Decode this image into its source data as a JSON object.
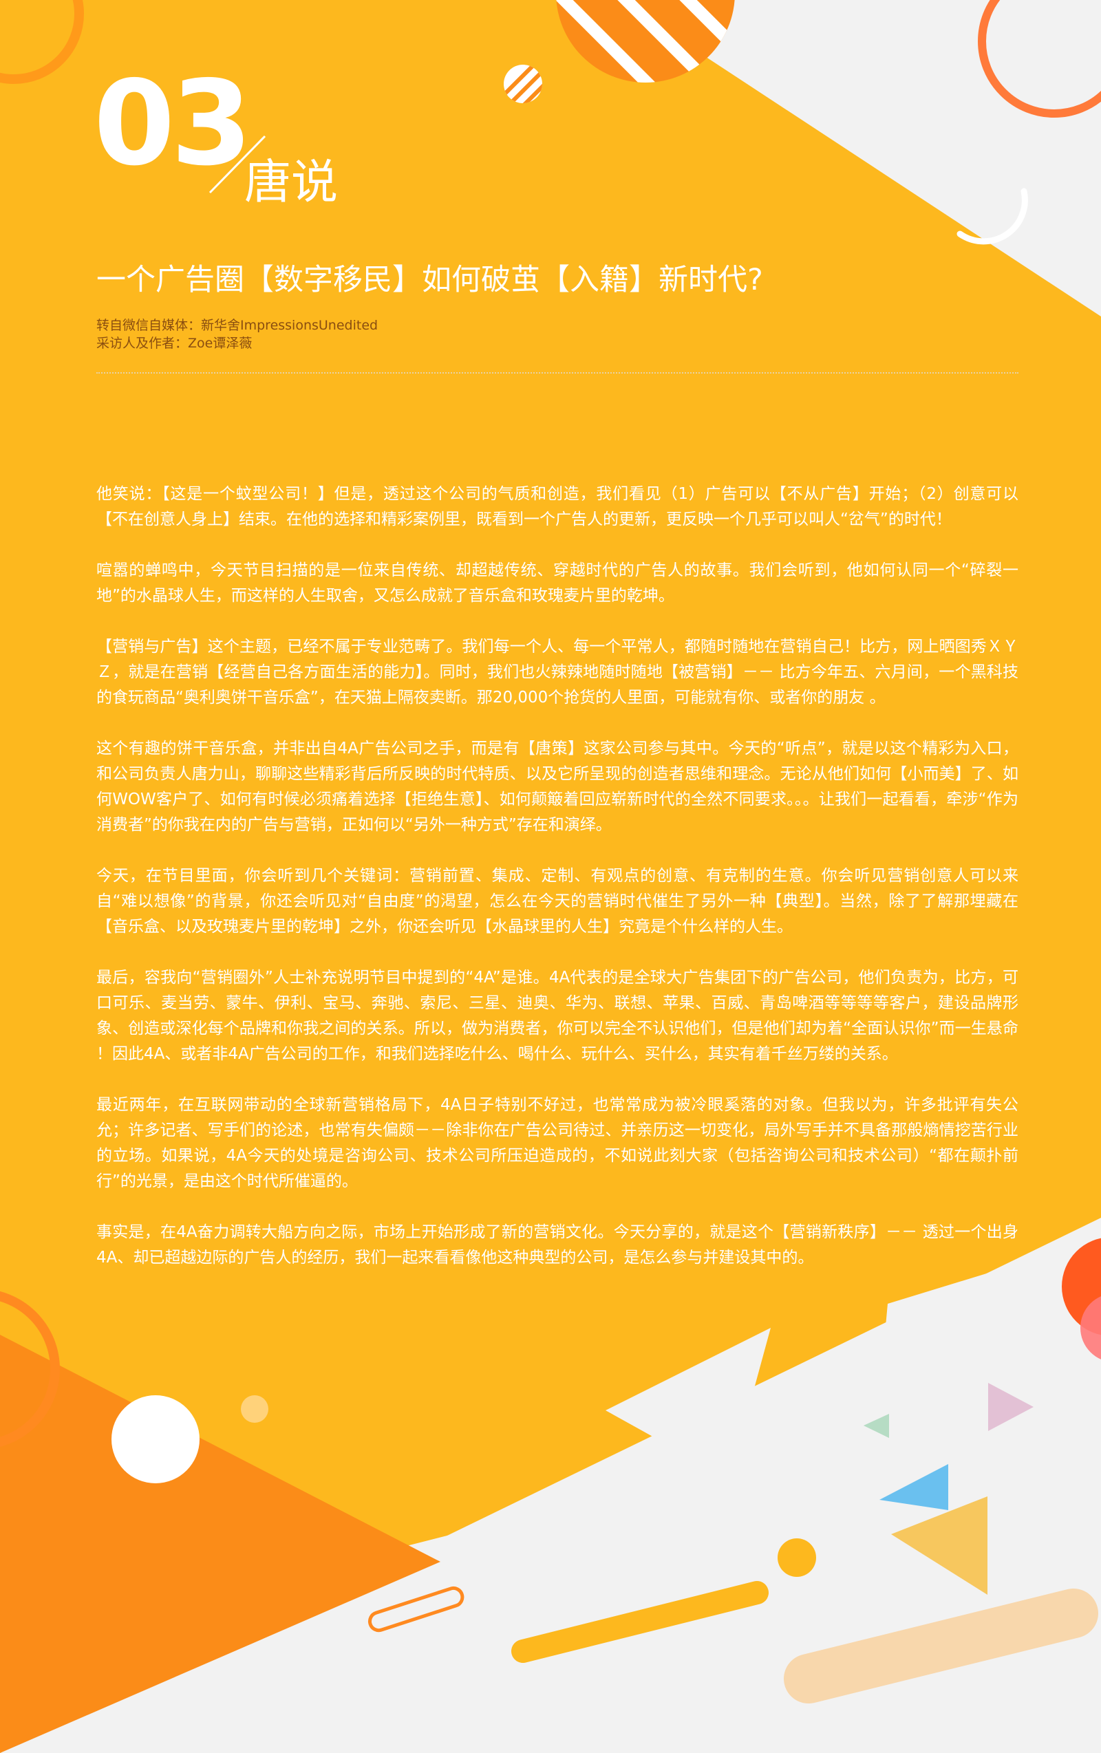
{
  "header": {
    "section_number": "03",
    "section_name": "唐说",
    "headline": "一个广告圈【数字移民】如何破茧【入籍】新时代?",
    "source_line": "转自微信自媒体：新华舍ImpressionsUnedited",
    "author_line": "采访人及作者：Zoe谭泽薇"
  },
  "article": {
    "paragraphs": [
      "他笑说：【这是一个蚊型公司！】但是，透过这个公司的气质和创造，我们看见（1）广告可以【不从广告】开始；（2）创意可以【不在创意人身上】结束。在他的选择和精彩案例里，既看到一个广告人的更新，更反映一个几乎可以叫人“岔气”的时代！",
      "喧嚣的蝉鸣中，今天节目扫描的是一位来自传统、却超越传统、穿越时代的广告人的故事。我们会听到，他如何认同一个“碎裂一地”的水晶球人生，而这样的人生取舍，又怎么成就了音乐盒和玫瑰麦片里的乾坤。",
      "【营销与广告】这个主题，已经不属于专业范畴了。我们每一个人、每一个平常人，都随时随地在营销自己！比方，网上晒图秀ＸＹＺ，就是在营销【经营自己各方面生活的能力】。同时，我们也火辣辣地随时随地【被营销】－－ 比方今年五、六月间，一个黑科技的食玩商品“奥利奥饼干音乐盒”，在天猫上隔夜卖断。那20,000个抢货的人里面，可能就有你、或者你的朋友 。",
      "这个有趣的饼干音乐盒，并非出自4A广告公司之手，而是有【唐策】这家公司参与其中。今天的“听点”，就是以这个精彩为入口，和公司负责人唐力山，聊聊这些精彩背后所反映的时代特质、以及它所呈现的创造者思维和理念。无论从他们如何【小而美】了、如何WOW客户了、如何有时候必须痛着选择【拒绝生意】、如何颠簸着回应崭新时代的全然不同要求。。。让我们一起看看，牵涉“作为消费者”的你我在内的广告与营销，正如何以“另外一种方式”存在和演绎。",
      "今天，在节目里面，你会听到几个关键词：营销前置、集成、定制、有观点的创意、有克制的生意。你会听见营销创意人可以来自“难以想像”的背景，你还会听见对“自由度”的渴望，怎么在今天的营销时代催生了另外一种【典型】。当然，除了了解那埋藏在【音乐盒、以及玫瑰麦片里的乾坤】之外，你还会听见【水晶球里的人生】究竟是个什么样的人生。",
      "最后，容我向“营销圈外”人士补充说明节目中提到的“4A”是谁。4A代表的是全球大广告集团下的广告公司，他们负责为，比方，可口可乐、麦当劳、蒙牛、伊利、宝马、奔驰、索尼、三星、迪奥、华为、联想、苹果、百威、青岛啤酒等等等等客户，建设品牌形象、创造或深化每个品牌和你我之间的关系。所以，做为消费者，你可以完全不认识他们，但是他们却为着“全面认识你”而一生悬命 ！因此4A、或者非4A广告公司的工作，和我们选择吃什么、喝什么、玩什么、买什么，其实有着千丝万缕的关系。",
      "最近两年，在互联网带动的全球新营销格局下，4A日子特别不好过，也常常成为被冷眼奚落的对象。但我以为，许多批评有失公允；许多记者、写手们的论述，也常有失偏颇－－除非你在广告公司待过、并亲历这一切变化，局外写手并不具备那般熵情挖苦行业的立场。如果说，4A今天的处境是咨询公司、技术公司所压迫造成的，不如说此刻大家（包括咨询公司和技术公司）“都在颠扑前行”的光景，是由这个时代所催逼的。",
      "事实是，在4A奋力调转大船方向之际，市场上开始形成了新的营销文化。今天分享的，就是这个【营销新秩序】－－ 透过一个出身4A、却已超越边际的广告人的经历，我们一起来看看像他这种典型的公司，是怎么参与并建设其中的。"
    ]
  },
  "colors": {
    "main_yellow": "#fdb81e",
    "deep_orange": "#fb8c18",
    "orange_ring": "#ff7a3a",
    "background_gray": "#f2f2f2",
    "meta_text": "#8a4e10"
  }
}
